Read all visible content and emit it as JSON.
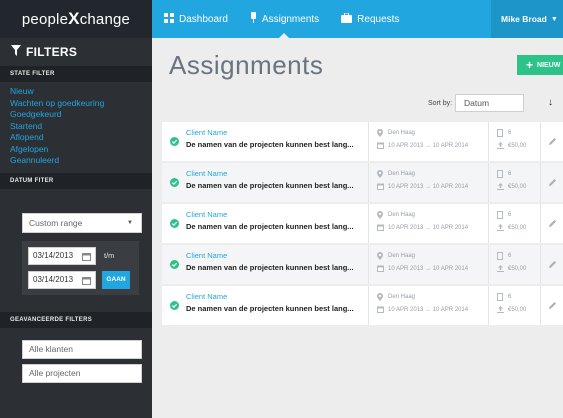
{
  "brand": {
    "left": "people",
    "mark": "X",
    "right": "change"
  },
  "nav": {
    "items": [
      {
        "label": "Dashboard",
        "icon": "grid-icon"
      },
      {
        "label": "Assignments",
        "icon": "pin-icon",
        "active": true
      },
      {
        "label": "Requests",
        "icon": "briefcase-icon"
      }
    ],
    "user": "Mike Broad"
  },
  "sidebar": {
    "title": "FILTERS",
    "state_filter_label": "STATE FILTER",
    "states": [
      "Nieuw",
      "Wachten op goedkeuring",
      "Goedgekeurd",
      "Startend",
      "Aflopend",
      "Afgelopen",
      "Geannuleerd"
    ],
    "date_filter_label": "DATUM FITER",
    "range_select": "Custom range",
    "date_from": "03/14/2013",
    "date_to": "03/14/2013",
    "until_label": "t/m",
    "go_label": "GAAN",
    "advanced_label": "GEAVANCEERDE FILTERS",
    "clients_placeholder": "Alle klanten",
    "projects_placeholder": "Alle projecten"
  },
  "main": {
    "title": "Assignments",
    "new_button": "NIEUW",
    "sort_label": "Sort by:",
    "sort_value": "Datum"
  },
  "rows": [
    {
      "client": "Client Name",
      "project": "De namen van de projecten kunnen best lang...",
      "location": "Den Haag",
      "dates": "10 APR 2013 → 10 APR 2014",
      "count": "6",
      "amount": "€50,00"
    },
    {
      "client": "Client Name",
      "project": "De namen van de projecten kunnen best lang...",
      "location": "Den Haag",
      "dates": "10 APR 2013 → 10 APR 2014",
      "count": "6",
      "amount": "€50,00"
    },
    {
      "client": "Client Name",
      "project": "De namen van de projecten kunnen best lang...",
      "location": "Den Haag",
      "dates": "10 APR 2013 → 10 APR 2014",
      "count": "6",
      "amount": "€50,00"
    },
    {
      "client": "Client Name",
      "project": "De namen van de projecten kunnen best lang...",
      "location": "Den Haag",
      "dates": "10 APR 2013 → 10 APR 2014",
      "count": "6",
      "amount": "€50,00"
    },
    {
      "client": "Client Name",
      "project": "De namen van de projecten kunnen best lang...",
      "location": "Den Haag",
      "dates": "10 APR 2013 → 10 APR 2014",
      "count": "6",
      "amount": "€50,00"
    }
  ],
  "colors": {
    "accent": "#22a6df",
    "dark": "#2c2f34",
    "success": "#2ec28b"
  }
}
